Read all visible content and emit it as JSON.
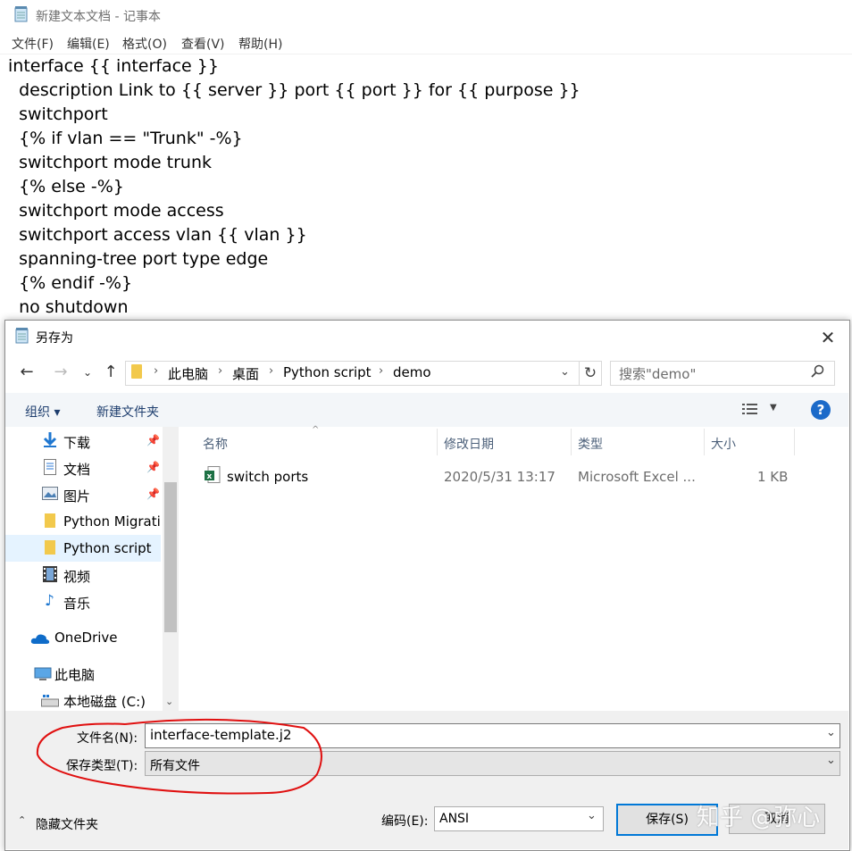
{
  "notepad": {
    "title": "新建文本文档 - 记事本",
    "menu": [
      "文件(F)",
      "编辑(E)",
      "格式(O)",
      "查看(V)",
      "帮助(H)"
    ],
    "lines": [
      "interface {{ interface }}",
      "  description Link to {{ server }} port {{ port }} for {{ purpose }}",
      "  switchport",
      "  {% if vlan == \"Trunk\" -%}",
      "  switchport mode trunk",
      "  {% else -%}",
      "  switchport mode access",
      "  switchport access vlan {{ vlan }}",
      "  spanning-tree port type edge",
      "  {% endif -%}",
      "  no shutdown"
    ]
  },
  "dialog": {
    "title": "另存为",
    "close": "✕",
    "breadcrumb": [
      "此电脑",
      "桌面",
      "Python script",
      "demo"
    ],
    "search_placeholder": "搜索\"demo\"",
    "toolbar": {
      "organize": "组织 ▾",
      "new_folder": "新建文件夹"
    },
    "nav": [
      {
        "label": "下载",
        "icon": "download-icon",
        "pinned": true
      },
      {
        "label": "文档",
        "icon": "document-icon",
        "pinned": true
      },
      {
        "label": "图片",
        "icon": "pictures-icon",
        "pinned": true
      },
      {
        "label": "Python Migrati",
        "icon": "folder-icon",
        "pinned": false
      },
      {
        "label": "Python script",
        "icon": "folder-icon",
        "pinned": false,
        "selected": true
      },
      {
        "label": "视频",
        "icon": "video-icon",
        "pinned": false
      },
      {
        "label": "音乐",
        "icon": "music-icon",
        "pinned": false
      },
      {
        "label": "OneDrive",
        "icon": "onedrive-icon",
        "pinned": false
      },
      {
        "label": "此电脑",
        "icon": "computer-icon",
        "pinned": false
      },
      {
        "label": "本地磁盘 (C:)",
        "icon": "drive-icon",
        "pinned": false
      }
    ],
    "columns": [
      "名称",
      "修改日期",
      "类型",
      "大小"
    ],
    "files": [
      {
        "name": "switch ports",
        "date": "2020/5/31 13:17",
        "type": "Microsoft Excel ...",
        "size": "1 KB"
      }
    ],
    "filename_label": "文件名(N):",
    "filename_value": "interface-template.j2",
    "filetype_label": "保存类型(T):",
    "filetype_value": "所有文件",
    "hide_folders": "隐藏文件夹",
    "encoding_label": "编码(E):",
    "encoding_value": "ANSI",
    "save": "保存(S)",
    "cancel": "取消"
  },
  "watermark": "知乎 @弥心",
  "colors": {
    "accent": "#0078d7",
    "selection": "#e5f3ff",
    "annotation": "#e01010"
  }
}
